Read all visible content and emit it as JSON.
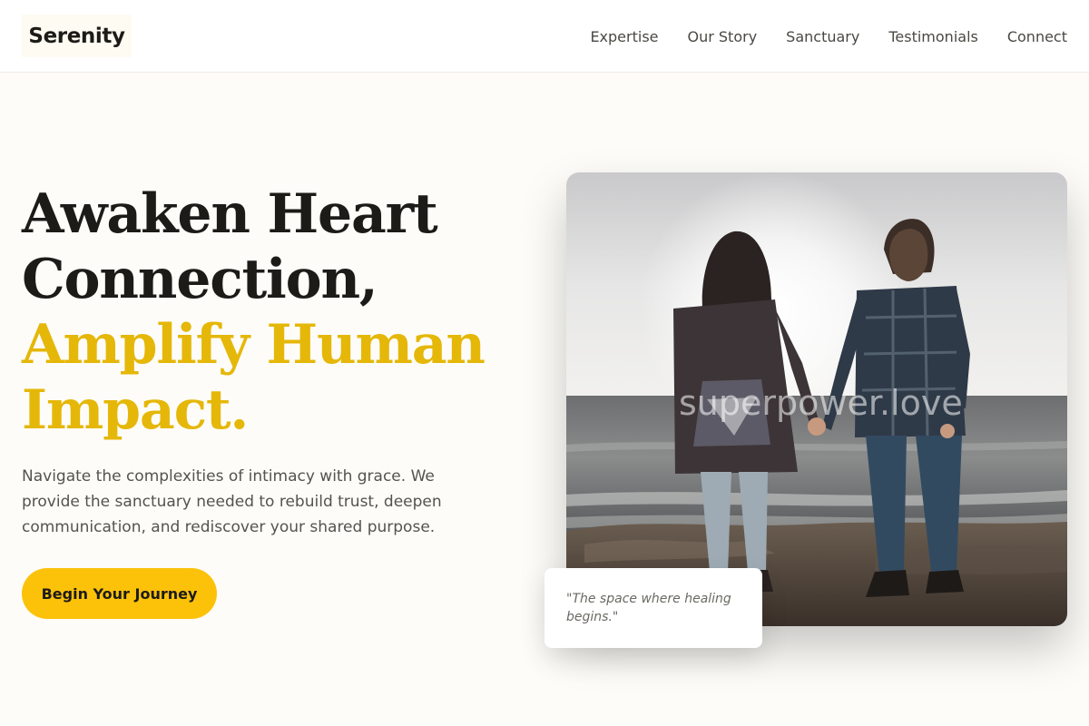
{
  "brand": {
    "name": "Serenity"
  },
  "nav": {
    "items": [
      {
        "label": "Expertise"
      },
      {
        "label": "Our Story"
      },
      {
        "label": "Sanctuary"
      },
      {
        "label": "Testimonials"
      },
      {
        "label": "Connect"
      }
    ]
  },
  "hero": {
    "title_line1": "Awaken Heart",
    "title_line2": "Connection,",
    "title_line3": "Amplify Human",
    "title_line4": "Impact.",
    "description": "Navigate the complexities of intimacy with grace. We provide the sanctuary needed to rebuild trust, deepen communication, and rediscover your shared purpose.",
    "cta_label": "Begin Your Journey"
  },
  "photo": {
    "watermark": "superpower.love",
    "quote": "\"The space where healing begins.\""
  },
  "colors": {
    "accent": "#e5b708",
    "button": "#fcc20a",
    "background": "#fdfcf8",
    "text": "#1c1b18"
  }
}
